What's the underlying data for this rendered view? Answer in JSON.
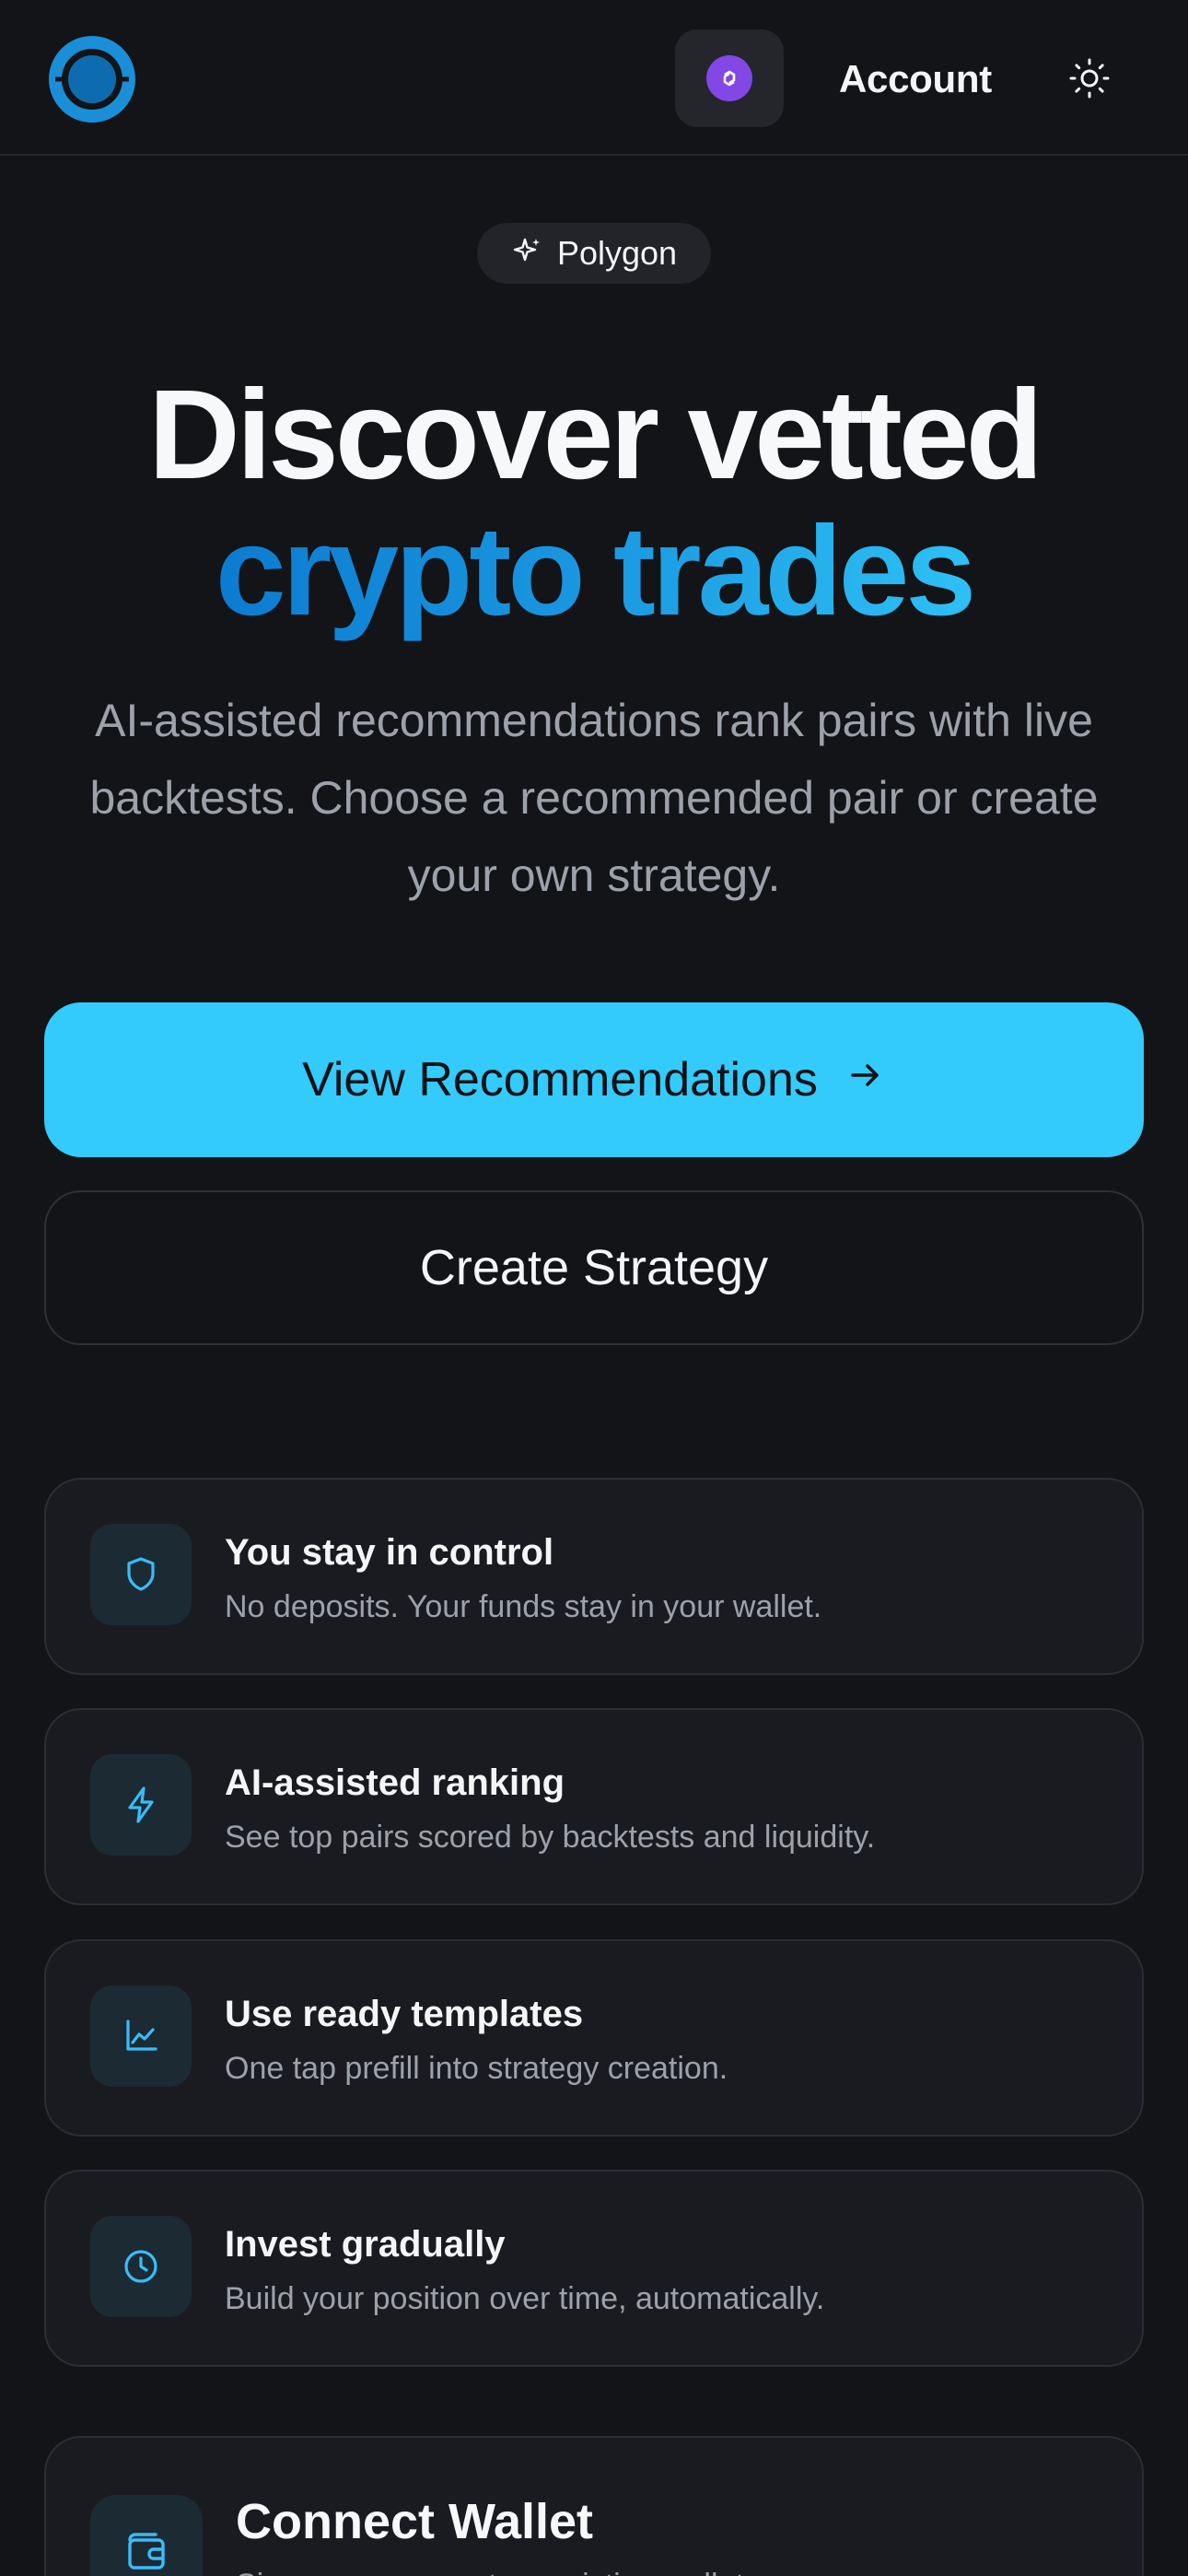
{
  "header": {
    "account_label": "Account"
  },
  "chip": {
    "label": "Polygon"
  },
  "hero": {
    "title_line1": "Discover vetted",
    "title_line2": "crypto trades",
    "subtitle": "AI-assisted recommendations rank pairs with live backtests. Choose a recommended pair or create your own strategy."
  },
  "actions": {
    "primary_label": "View Recommendations",
    "secondary_label": "Create Strategy"
  },
  "features": [
    {
      "icon": "shield-icon",
      "title": "You stay in control",
      "description": "No deposits. Your funds stay in your wallet."
    },
    {
      "icon": "lightning-icon",
      "title": "AI-assisted ranking",
      "description": "See top pairs scored by backtests and liquidity."
    },
    {
      "icon": "chart-line-icon",
      "title": "Use ready templates",
      "description": "One tap prefill into strategy creation."
    },
    {
      "icon": "clock-icon",
      "title": "Invest gradually",
      "description": "Build your position over time, automatically."
    }
  ],
  "wallet": {
    "title": "Connect Wallet",
    "description": "Sign up or connect an existing wallet"
  },
  "colors": {
    "background": "#131418",
    "accent": "#33cbfc",
    "gradient_start": "#0c7bd0",
    "gradient_end": "#2ec0f5",
    "polygon_purple": "#8247e5",
    "icon_accent": "#38bdf8"
  }
}
